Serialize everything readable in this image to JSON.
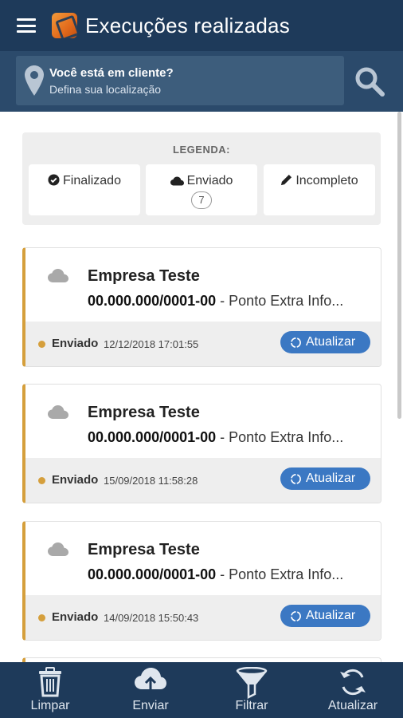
{
  "header": {
    "title": "Execuções realizadas",
    "menu_icon": "hamburger-icon",
    "logo": "app-logo"
  },
  "location": {
    "question": "Você está em cliente?",
    "subtitle": "Defina sua localização",
    "icon": "map-pin-icon",
    "search_icon": "search-icon"
  },
  "legend": {
    "title": "LEGENDA:",
    "items": [
      {
        "label": "Finalizado",
        "icon": "check-circle-icon"
      },
      {
        "label": "Enviado",
        "icon": "cloud-icon",
        "count": "7"
      },
      {
        "label": "Incompleto",
        "icon": "pencil-icon"
      }
    ]
  },
  "cards": [
    {
      "company": "Empresa Teste",
      "doc": "00.000.000/0001-00",
      "store": "- Ponto Extra Info...",
      "status": "Enviado",
      "datetime": "12/12/2018 17:01:55",
      "action": "Atualizar"
    },
    {
      "company": "Empresa Teste",
      "doc": "00.000.000/0001-00",
      "store": "- Ponto Extra Info...",
      "status": "Enviado",
      "datetime": "15/09/2018 11:58:28",
      "action": "Atualizar"
    },
    {
      "company": "Empresa Teste",
      "doc": "00.000.000/0001-00",
      "store": "- Ponto Extra Info...",
      "status": "Enviado",
      "datetime": "14/09/2018 15:50:43",
      "action": "Atualizar"
    }
  ],
  "bottom_nav": [
    {
      "label": "Limpar",
      "icon": "trash-icon"
    },
    {
      "label": "Enviar",
      "icon": "cloud-upload-icon"
    },
    {
      "label": "Filtrar",
      "icon": "filter-icon"
    },
    {
      "label": "Atualizar",
      "icon": "refresh-icon"
    }
  ],
  "colors": {
    "primary": "#1e3a5a",
    "accent": "#d59f3c",
    "button": "#3b78c3"
  }
}
